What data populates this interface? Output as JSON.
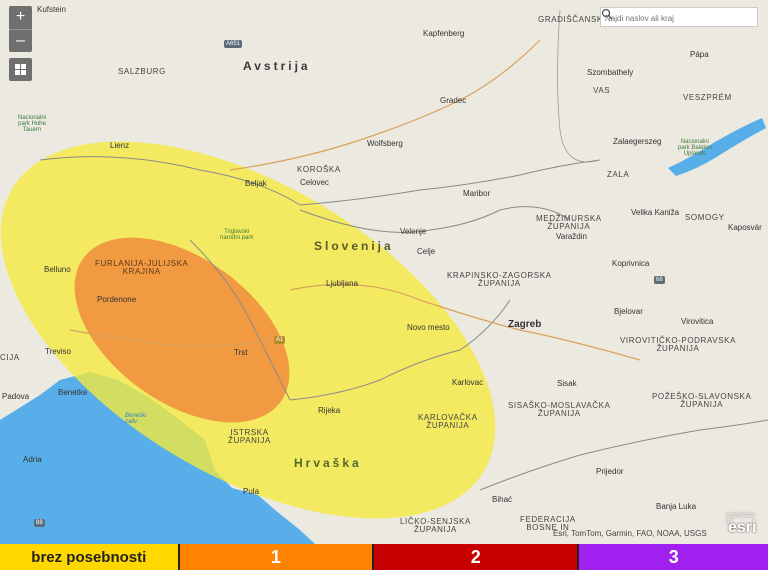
{
  "search": {
    "placeholder": "Najdi naslov ali kraj"
  },
  "zoom": {
    "in_label": "+",
    "out_label": "–"
  },
  "countries": {
    "austria": "Avstrija",
    "slovenia": "Slovenija",
    "croatia": "Hrvaška"
  },
  "regions": {
    "salzburg": "SALZBURG",
    "koroska": "KOROŠKA",
    "vas": "VAS",
    "veszprem": "VESZPRÉM",
    "zala": "ZALA",
    "somogy": "SOMOGY",
    "medzimurska": "MEDŽIMURSKA\nŽUPANIJA",
    "krapinsko": "KRAPINSKO-ZAGORSKA\nŽUPANIJA",
    "furlanija": "FURLANIJA-JULIJSKA\nKRAJINA",
    "viroviticko": "VIROVITIČKO-PODRAVSKA\nŽUPANIJA",
    "sisacko": "SISAŠKO-MOSLAVAČKA\nŽUPANIJA",
    "pozesko": "POŽEŠKO-SLAVONSKA\nŽUPANIJA",
    "karlovacka": "KARLOVAČKA\nŽUPANIJA",
    "istrska": "ISTRSKA\nŽUPANIJA",
    "licko": "LIČKO-SENJSKA\nŽUPANIJA",
    "federacija": "FEDERACIJA\nBOSNE IN",
    "gradiscansko": "GRADIŠČANSK",
    "cija": "CIJA"
  },
  "cities": {
    "kufstein": "Kufstein",
    "kapfenberg": "Kapfenberg",
    "papa": "Pápa",
    "szombathely": "Szombathely",
    "gradec": "Gradec",
    "wolfsberg": "Wolfsberg",
    "lienz": "Lienz",
    "beljak": "Beljak",
    "celovec": "Celovec",
    "maribor": "Maribor",
    "zalaegerszeg": "Zalaegerszeg",
    "velika_kanizsa": "Velika Kaniža",
    "kaposvar": "Kaposvár",
    "velenje": "Velenje",
    "celje": "Celje",
    "varazdin": "Varaždin",
    "belluno": "Belluno",
    "koprivnica": "Koprivnica",
    "pordenone": "Pordenone",
    "ljubljana": "Ljubljana",
    "bjelovar": "Bjelovar",
    "novo_mesto": "Novo mesto",
    "zagreb": "Zagreb",
    "virovitica": "Virovitica",
    "treviso": "Treviso",
    "trst": "Trst",
    "karlovac": "Karlovac",
    "sisak": "Sisak",
    "padova": "Padova",
    "benetke": "Benetke",
    "rijeka": "Rijeka",
    "adria": "Adria",
    "pula": "Pula",
    "prijedor": "Prijedor",
    "bihac": "Bihać",
    "banja_luka": "Banja Luka"
  },
  "parks": {
    "hohe_tauern": "Nacionalni\npark Hohe\nTauern",
    "triglavski": "Triglavski\nnarodni park",
    "balaton": "Nacionalni\npark Balaton\nUplands"
  },
  "water": {
    "beneski_zaliv": "Beneški\nzaliv"
  },
  "road_shields": {
    "a651": "A651",
    "n68": "68",
    "a1": "A1",
    "n88": "88"
  },
  "attribution": "Esri, TomTom, Garmin, FAO, NOAA, USGS",
  "esri": {
    "powered": "POWERED BY",
    "brand": "esri"
  },
  "legend": [
    {
      "label": "brez posebnosti",
      "color": "#ffd800"
    },
    {
      "label": "1",
      "color": "#ff8200"
    },
    {
      "label": "2",
      "color": "#c80000"
    },
    {
      "label": "3",
      "color": "#a020f0"
    }
  ],
  "warning_areas": [
    {
      "level": "brez posebnosti",
      "color": "#f5eb3c"
    },
    {
      "level": "1",
      "color": "#f08c3c"
    }
  ]
}
